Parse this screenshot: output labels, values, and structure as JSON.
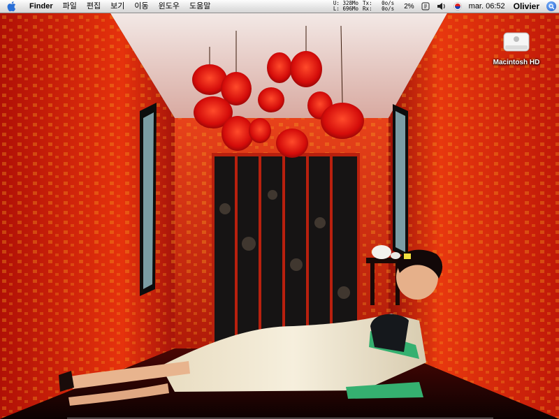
{
  "menubar": {
    "app_name": "Finder",
    "menus": [
      "파일",
      "편집",
      "보기",
      "이동",
      "윈도우",
      "도움말"
    ],
    "stats": {
      "u_label": "U:",
      "u_value": "328Mo",
      "l_label": "L:",
      "l_value": "696Mo",
      "tx_label": "Tx:",
      "tx_value": "0o/s",
      "rx_label": "Rx:",
      "rx_value": "0o/s"
    },
    "cpu": "2%",
    "clock": "mar. 06:52",
    "user": "Olivier"
  },
  "desktop": {
    "drive_label": "Macintosh HD"
  },
  "dock": {
    "icons": [
      "finder-icon",
      "dashboard-icon",
      "safari-icon",
      "mail-icon",
      "ichat-icon",
      "itunes-icon",
      "preview-icon",
      "skype-icon",
      "firefox-icon",
      "terminal-icon",
      "app-icon-1",
      "app-icon-2",
      "app-icon-3",
      "app-icon-4",
      "app-icon-5",
      "app-icon-6",
      "app-icon-7",
      "app-icon-8",
      "app-icon-9",
      "app-icon-10",
      "app-icon-11",
      "app-icon-12",
      "app-icon-13",
      "app-icon-14",
      "app-icon-15",
      "app-icon-16",
      "app-icon-17",
      "app-icon-18",
      "app-icon-19",
      "app-icon-20",
      "app-icon-21",
      "app-icon-22",
      "app-icon-23",
      "app-icon-24",
      "trash-icon"
    ],
    "colors": [
      "#3a6fd8",
      "#6a6a6a",
      "#2d8be0",
      "#7fa0c8",
      "#5a9ad8",
      "#3fb04a",
      "#d6a820",
      "#1aa8e0",
      "#e07820",
      "#222222",
      "#c03a2a",
      "#8a8a8a",
      "#e0b820",
      "#4a7ad0",
      "#6aa0e0",
      "#c8c8c8",
      "#2a5ab0",
      "#d83a3a",
      "#3a8a3a",
      "#a04ad0",
      "#e0e0e0",
      "#3a6a9a",
      "#f0a030",
      "#7a7ad0",
      "#2aa0a0",
      "#d05a8a",
      "#5aa03a",
      "#b0b0b0",
      "#3a3a3a",
      "#e0e030",
      "#2a8ad0",
      "#d06030",
      "#606060",
      "#80c0ff",
      "#cfd6dc"
    ]
  }
}
